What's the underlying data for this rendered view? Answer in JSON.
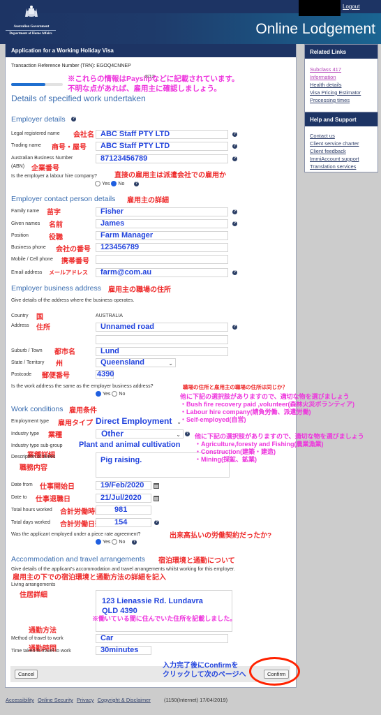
{
  "header": {
    "gov_line1": "Australian Government",
    "gov_line2": "Department of Home Affairs",
    "logout": "Logout",
    "title": "Online Lodgement"
  },
  "main": {
    "heading": "Application for a Working Holiday Visa",
    "trn": "Transaction Reference Number (TRN): EGOQ4CNNEP",
    "step": "8/12",
    "progress_fraction": 0.667,
    "page_title": "Details of specified work undertaken",
    "note_top_1": "※これらの情報はPayslipなどに記載されています。",
    "note_top_2": "不明な点があれば、雇用主に確認しましょう。"
  },
  "employer_details": {
    "title": "Employer details",
    "legal_name_label": "Legal registered name",
    "legal_name_jp": "会社名",
    "legal_name_value": "ABC Staff PTY LTD",
    "trading_name_label": "Trading name",
    "trading_name_jp": "商号・屋号",
    "trading_name_value": "ABC Staff PTY LTD",
    "abn_label_1": "Australian Business Number",
    "abn_label_2": "(ABN)",
    "abn_jp": "企業番号",
    "abn_value": "87123456789",
    "labour_hire_q": "Is the employer a labour hire company?",
    "labour_hire_jp": "直接の雇用主は派遣会社での雇用か",
    "yes": "Yes",
    "no": "No",
    "labour_hire_selected": "No"
  },
  "contact": {
    "title": "Employer contact person details",
    "title_jp": "雇用主の詳細",
    "family_label": "Family name",
    "family_jp": "苗字",
    "family_value": "Fisher",
    "given_label": "Given names",
    "given_jp": "名前",
    "given_value": "James",
    "position_label": "Position",
    "position_jp": "役職",
    "position_value": "Farm Manager",
    "phone_label": "Business phone",
    "phone_jp": "会社の番号",
    "phone_value": "123456789",
    "mobile_label": "Mobile / Cell phone",
    "mobile_jp": "携帯番号",
    "mobile_value": "",
    "email_label": "Email address",
    "email_jp": "メールアドレス",
    "email_value": "farm@com.au"
  },
  "address": {
    "title": "Employer business address",
    "title_jp": "雇用主の職場の住所",
    "desc": "Give details of the address where the business operates.",
    "country_label": "Country",
    "country_jp": "国",
    "country_value": "AUSTRALIA",
    "address_label": "Address",
    "address_jp": "住所",
    "address_value": "Unnamed road",
    "address2_value": "",
    "suburb_label": "Suburb / Town",
    "suburb_jp": "都市名",
    "suburb_value": "Lund",
    "state_label": "State / Territory",
    "state_jp": "州",
    "state_value": "Queensland",
    "postcode_label": "Postcode",
    "postcode_jp": "郵便番号",
    "postcode_value": "4390",
    "same_q": "Is the work address the same as the employer business address?",
    "same_jp": "職場の住所と雇用主の職場の住所は同じか？",
    "same_selected": "Yes"
  },
  "notes_employment": {
    "line0": "他に下記の選択肢がありますので、適切な物を選びましょう",
    "line1": "・Bush fire recovery paid ,volunteer(森林火災ボランティア)",
    "line2": "・Labour hire company(請負労働、派遣労働)",
    "line3": "・Self-employed(自営)"
  },
  "notes_industry": {
    "line0": "他に下記の選択肢がありますので、適切な物を選びましょう",
    "line1": "・Agriculture,foresty and Fishing(農業漁業)",
    "line2": "・Construction(建築・建造)",
    "line3": "・Mining(採鉱、鉱業)"
  },
  "work": {
    "title": "Work conditions",
    "title_jp": "雇用条件",
    "emp_type_label": "Employment type",
    "emp_type_jp": "雇用タイプ",
    "emp_type_value": "Direct Employment",
    "industry_label": "Industry type",
    "industry_jp": "業種",
    "industry_value": "Other",
    "subgroup_label": "Industry type sub-group",
    "subgroup_jp": "業種詳細",
    "subgroup_value": "Plant and animal cultivation",
    "duties_label": "Description of duties",
    "duties_jp": "職務内容",
    "duties_value": "Pig raising.",
    "from_label": "Date from",
    "from_jp": "仕事開始日",
    "from_value": "19/Feb/2020",
    "to_label": "Date to",
    "to_jp": "仕事退職日",
    "to_value": "21/Jul/2020",
    "hours_label": "Total hours worked",
    "hours_jp": "合計労働時間",
    "hours_value": "981",
    "days_label": "Total days worked",
    "days_jp": "合計労働日数",
    "days_value": "154",
    "piece_q": "Was the applicant employed under a piece rate agreement?",
    "piece_jp": "出来高払いの労働契約だったか?",
    "piece_selected": "Yes"
  },
  "accommodation": {
    "title": "Accommodation and travel arrangements",
    "title_jp": "宿泊環境と通勤について",
    "desc": "Give details of the applicant's accommodation and travel arrangements whilst working for this employer.",
    "desc_jp": "雇用主の下での宿泊環境と通勤方法の詳細を記入",
    "living_label": "Living arrangements",
    "living_jp": "住居詳細",
    "living_line1": "123 Lienassie Rd. Lundavra",
    "living_line2": "QLD 4390",
    "living_note": "※働いている間に住んでいた住所を記載しました。",
    "method_label": "Method of travel to work",
    "method_jp": "通勤方法",
    "method_value": "Car",
    "time_label": "Time taken to travel to work",
    "time_jp": "通勤時間",
    "time_value": "30minutes"
  },
  "actions": {
    "cancel": "Cancel",
    "confirm": "Confirm",
    "note_1": "入力完了後にConfirmを",
    "note_2": "クリックして次のページへ"
  },
  "related_links": {
    "title": "Related Links",
    "items": [
      "Subclass 417",
      "Information",
      "Health details",
      "Visa Pricing Estimator",
      "Processing times"
    ]
  },
  "help_support": {
    "title": "Help and Support",
    "items": [
      "Contact us",
      "Client service charter",
      "Client feedback",
      "ImmiAccount support",
      "Translation services"
    ]
  },
  "footer": {
    "links": [
      "Accessibility",
      "Online Security",
      "Privacy",
      "Copyright & Disclaimer"
    ],
    "version": "(1150(Internet) 17/04/2019)"
  },
  "colors": {
    "brand_navy": "#1d3464",
    "brand_teal": "#1a6592",
    "section_blue": "#3a6db0",
    "annotation_red": "#ee2a2a",
    "annotation_magenta": "#ee33dd",
    "input_blue": "#2244dd"
  }
}
